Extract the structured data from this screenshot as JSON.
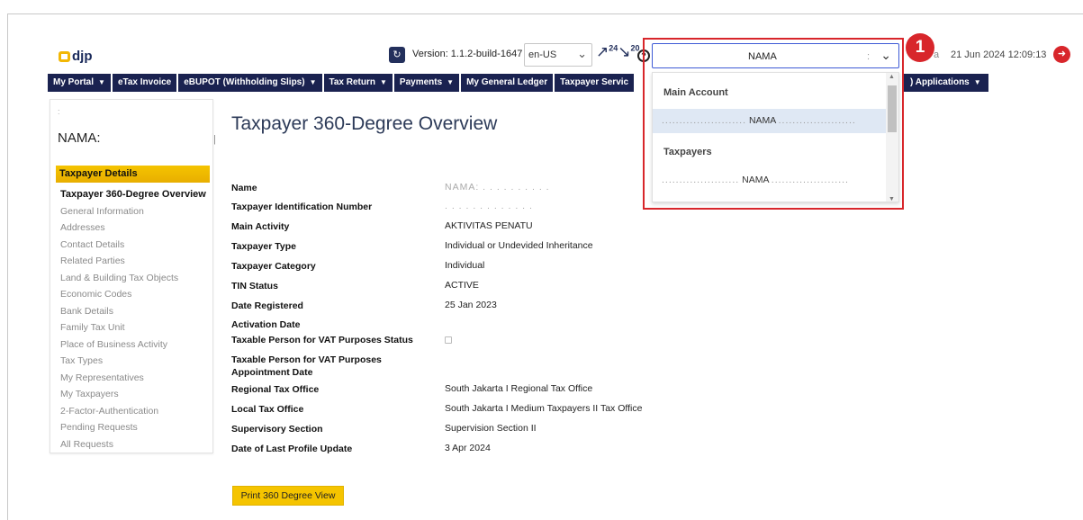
{
  "header": {
    "logo_text": "djp",
    "version_icon": "refresh-icon",
    "version_label": "Version: 1.1.2-build-1647",
    "language": "en-US",
    "notification_count_1": "24",
    "notification_count_2": "20",
    "help_symbol": "?",
    "account_value": "NAMA",
    "account_sep": ":",
    "step_number": "1",
    "datetime": "21 Jun 2024 12:09:13",
    "datetime_prefix": "a"
  },
  "nav": {
    "items": [
      "My Portal",
      "eTax Invoice",
      "eBUPOT (Withholding Slips)",
      "Tax Return",
      "Payments",
      "My General Ledger",
      "Taxpayer Servic"
    ],
    "right_item": ") Applications"
  },
  "dropdown": {
    "group_main": "Main Account",
    "main_option": {
      "prefix": "........................",
      "name": "NAMA",
      "suffix": "......................"
    },
    "group_taxpayers": "Taxpayers",
    "taxpayer_option": {
      "prefix": "......................",
      "name": "NAMA",
      "suffix": "......................"
    }
  },
  "sidebar": {
    "dot": ":",
    "name": "NAMA:",
    "tick": "|",
    "section_header": "Taxpayer Details",
    "items": [
      {
        "label": "Taxpayer 360-Degree Overview",
        "active": true
      },
      {
        "label": "General Information"
      },
      {
        "label": "Addresses"
      },
      {
        "label": "Contact Details"
      },
      {
        "label": "Related Parties"
      },
      {
        "label": "Land & Building Tax Objects"
      },
      {
        "label": "Economic Codes"
      },
      {
        "label": "Bank Details"
      },
      {
        "label": "Family Tax Unit"
      },
      {
        "label": "Place of Business Activity"
      },
      {
        "label": "Tax Types"
      },
      {
        "label": "My Representatives"
      },
      {
        "label": "My Taxpayers"
      },
      {
        "label": "2-Factor-Authentication"
      },
      {
        "label": "Pending Requests"
      },
      {
        "label": "All Requests"
      }
    ]
  },
  "main": {
    "title": "Taxpayer 360-Degree Overview",
    "fields": [
      {
        "label": "Name",
        "value": "NAMA: . . . . . . . . . ."
      },
      {
        "label": "Taxpayer Identification Number",
        "value": ". . . . . . . . . . . . ."
      },
      {
        "label": "Main Activity",
        "value": "AKTIVITAS PENATU"
      },
      {
        "label": "Taxpayer Type",
        "value": "Individual or Undevided Inheritance"
      },
      {
        "label": "Taxpayer Category",
        "value": "Individual"
      },
      {
        "label": "TIN Status",
        "value": "ACTIVE"
      },
      {
        "label": "Date Registered",
        "value": "25 Jan 2023"
      },
      {
        "label": "Activation Date",
        "value": ""
      },
      {
        "label": "Taxable Person for VAT Purposes Status",
        "value": ""
      },
      {
        "label": "Taxable Person for VAT Purposes Appointment Date",
        "value": ""
      },
      {
        "label": "Regional Tax Office",
        "value": "South Jakarta I Regional Tax Office"
      },
      {
        "label": "Local Tax Office",
        "value": "South Jakarta I Medium Taxpayers II Tax Office"
      },
      {
        "label": "Supervisory Section",
        "value": "Supervision Section II"
      },
      {
        "label": "Date of Last Profile Update",
        "value": "3 Apr 2024"
      }
    ],
    "print_button": "Print 360 Degree View"
  }
}
